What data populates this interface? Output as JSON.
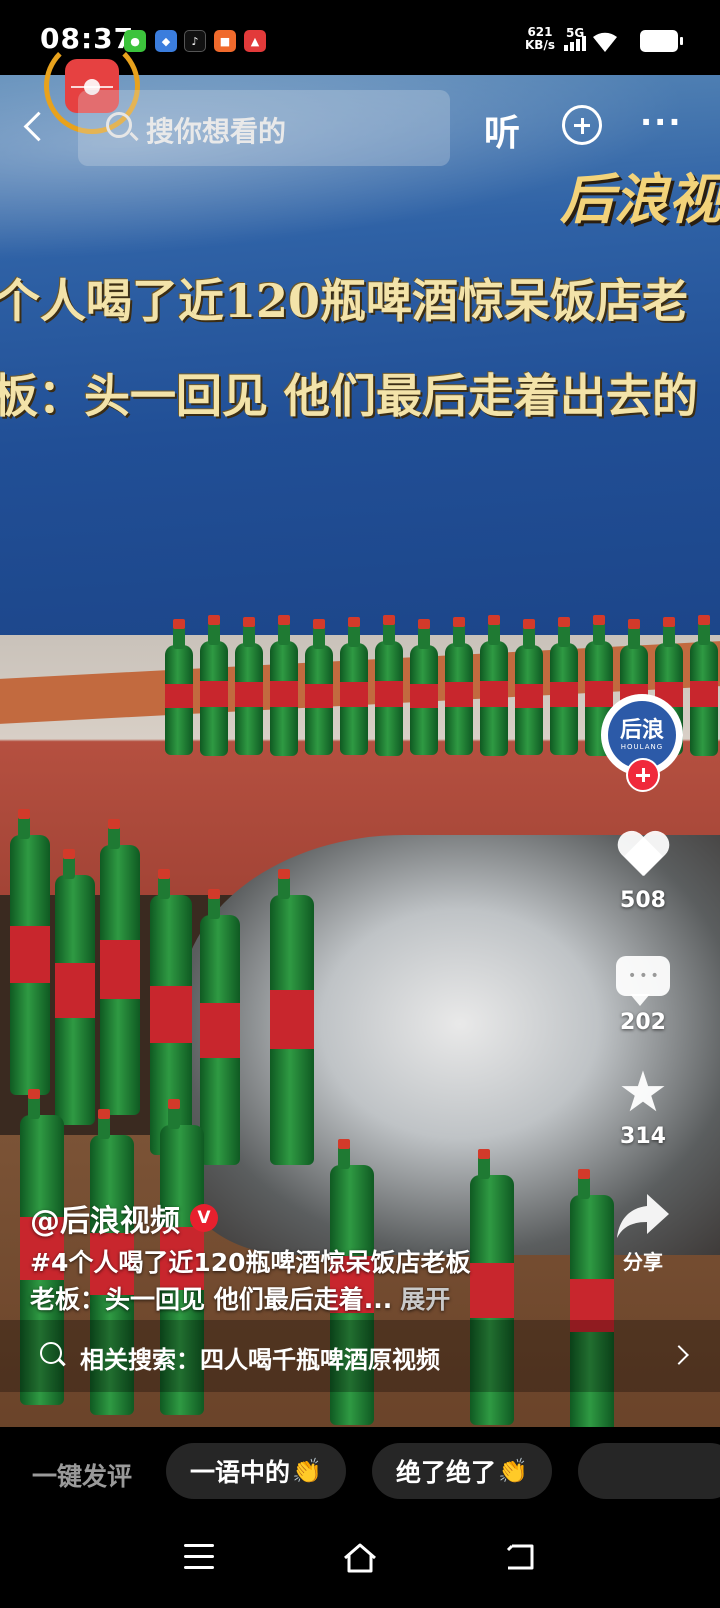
{
  "status_bar": {
    "time": "08:37",
    "net_speed_value": "621",
    "net_speed_unit": "KB/s",
    "signal_label": "5G",
    "app_icons": [
      {
        "name": "wechat-icon",
        "color": "#3cc33c"
      },
      {
        "name": "app-icon-blue",
        "color": "#3b7ddd"
      },
      {
        "name": "tiktok-icon",
        "color": "#111111"
      },
      {
        "name": "app-icon-orange",
        "color": "#f06a2c"
      },
      {
        "name": "app-icon-red",
        "color": "#e23a3a"
      }
    ]
  },
  "top_nav": {
    "search_placeholder": "搜你想看的",
    "listen_label": "听",
    "more_label": "···"
  },
  "video": {
    "caption_line1": "个人喝了近120瓶啤酒惊呆饭店老",
    "caption_line2": "板：头一回见 他们最后走着出去的",
    "brand_text": "后浪视"
  },
  "actions": {
    "avatar_text": "后浪",
    "avatar_subtext": "HOULANG",
    "likes": "508",
    "comments": "202",
    "favorites": "314",
    "share_label": "分享"
  },
  "post": {
    "author": "@后浪视频",
    "verified_badge": "V",
    "desc_line1": "#4个人喝了近120瓶啤酒惊呆饭店老板",
    "desc_line2": "老板：头一回见 他们最后走着...",
    "expand_label": "展开"
  },
  "related_search": {
    "text": "相关搜索：四人喝千瓶啤酒原视频"
  },
  "quick_comments": {
    "label": "一键发评",
    "chips": [
      {
        "text": "一语中的",
        "emoji": "👏"
      },
      {
        "text": "绝了绝了",
        "emoji": "👏"
      }
    ]
  }
}
